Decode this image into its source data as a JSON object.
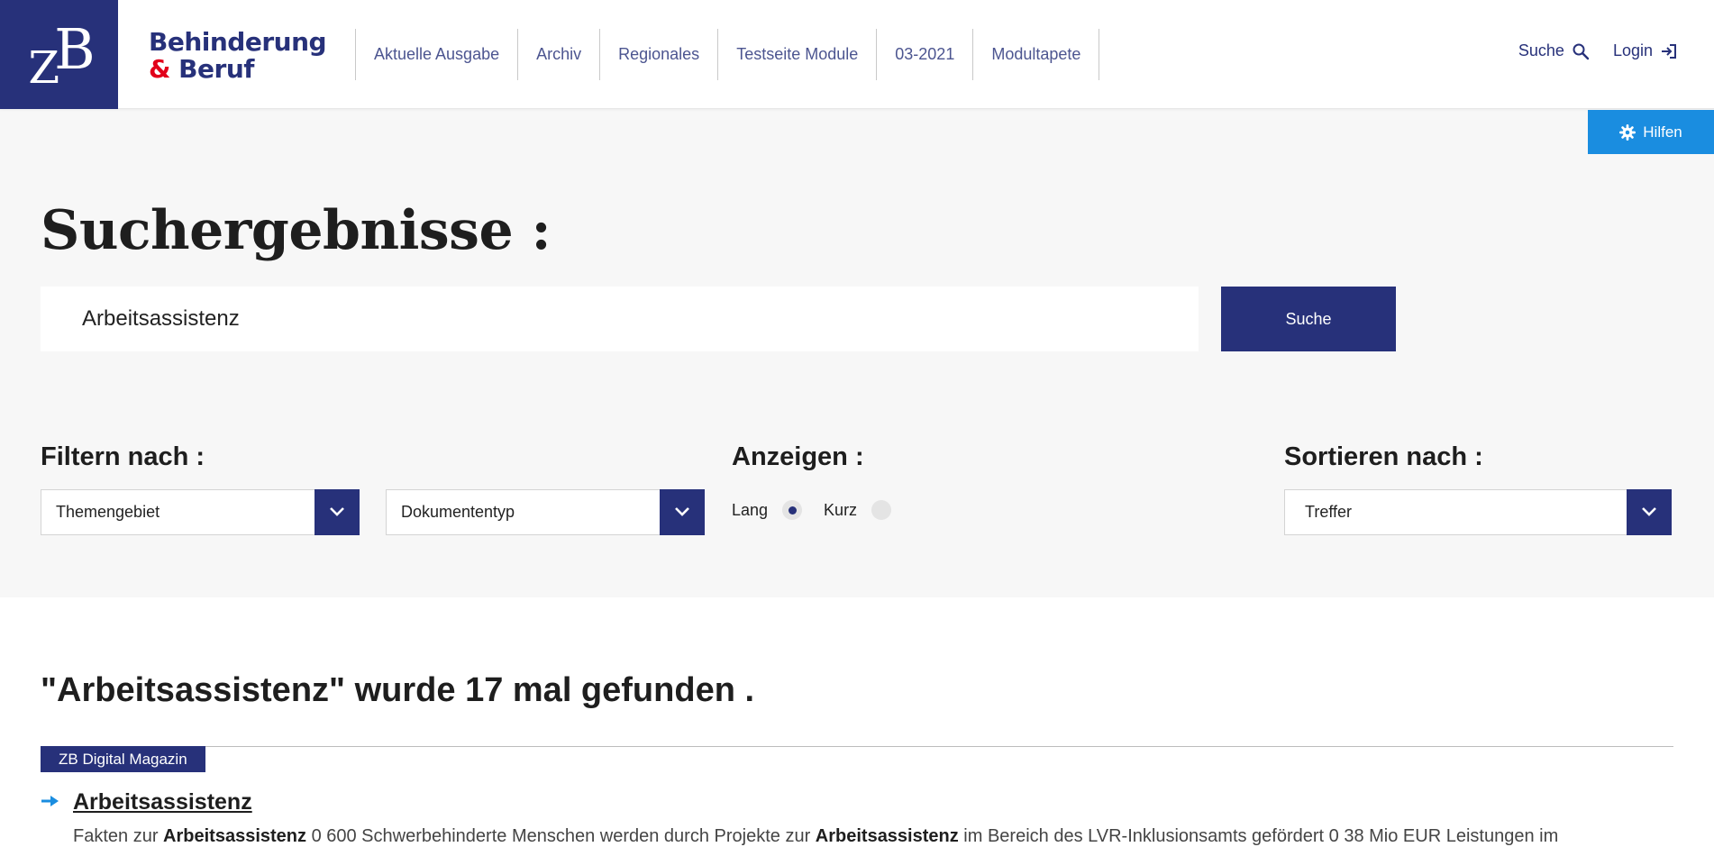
{
  "header": {
    "logo_text": "ZB",
    "brand_line1": "Behinderung",
    "brand_amp": "&",
    "brand_line2": "Beruf",
    "nav": [
      "Aktuelle Ausgabe",
      "Archiv",
      "Regionales",
      "Testseite Module",
      "03-2021",
      "Modultapete"
    ],
    "search_label": "Suche",
    "login_label": "Login"
  },
  "hilfen": {
    "label": "Hilfen",
    "icon": "gear-icon",
    "color": "#1a8de0"
  },
  "search": {
    "title": "Suchergebnisse :",
    "query": "Arbeitsassistenz",
    "button_label": "Suche"
  },
  "filters": {
    "label": "Filtern nach :",
    "topic_select": "Themengebiet",
    "doctype_select": "Dokumententyp"
  },
  "display": {
    "label": "Anzeigen :",
    "options": [
      {
        "label": "Lang",
        "checked": true
      },
      {
        "label": "Kurz",
        "checked": false
      }
    ]
  },
  "sort": {
    "label": "Sortieren nach :",
    "selected": "Treffer"
  },
  "results": {
    "heading": "\"Arbeitsassistenz\" wurde 17 mal gefunden .",
    "items": [
      {
        "category": "ZB Digital Magazin",
        "title": "Arbeitsassistenz",
        "snippet_parts": [
          {
            "text": "Fakten zur ",
            "bold": false
          },
          {
            "text": "Arbeitsassistenz",
            "bold": true
          },
          {
            "text": " 0 600 Schwerbehinderte Menschen werden durch Projekte zur ",
            "bold": false
          },
          {
            "text": "Arbeitsassistenz",
            "bold": true
          },
          {
            "text": " im Bereich des LVR-Inklusionsamts gefördert 0 38 Mio EUR Leistungen im",
            "bold": false
          }
        ]
      }
    ]
  },
  "colors": {
    "primary": "#27317a",
    "accent_red": "#e2001a",
    "link_arrow": "#1a8de0"
  }
}
